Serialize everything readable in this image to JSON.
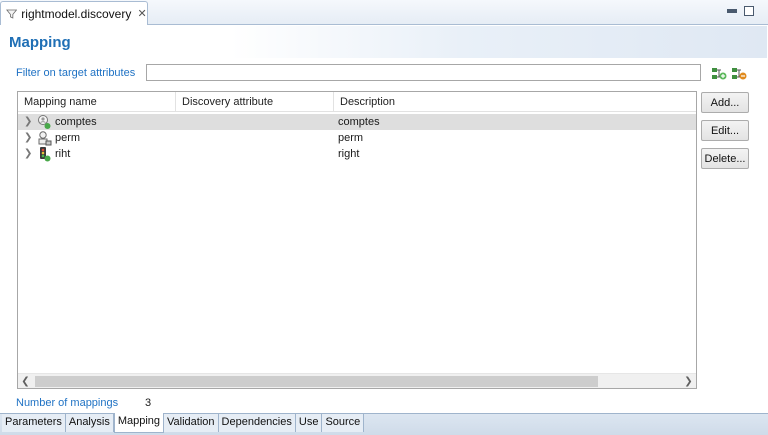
{
  "editor_tab": {
    "label": "rightmodel.discovery",
    "icon": "filter-icon"
  },
  "page_title": "Mapping",
  "filter": {
    "label": "Filter on target attributes",
    "value": "",
    "placeholder": ""
  },
  "table": {
    "columns": [
      "Mapping name",
      "Discovery attribute",
      "Description"
    ],
    "rows": [
      {
        "name": "comptes",
        "discovery_attribute": "",
        "description": "comptes",
        "icon": "account-icon",
        "selected": true
      },
      {
        "name": "perm",
        "discovery_attribute": "",
        "description": "perm",
        "icon": "permission-icon",
        "selected": false
      },
      {
        "name": "riht",
        "discovery_attribute": "",
        "description": "right",
        "icon": "right-icon",
        "selected": false
      }
    ]
  },
  "buttons": {
    "add": "Add...",
    "edit": "Edit...",
    "delete": "Delete..."
  },
  "mapping_count": {
    "label": "Number of mappings",
    "value": "3"
  },
  "page_tabs": [
    {
      "label": "Parameters",
      "active": false
    },
    {
      "label": "Analysis",
      "active": false
    },
    {
      "label": "Mapping",
      "active": true
    },
    {
      "label": "Validation",
      "active": false
    },
    {
      "label": "Dependencies",
      "active": false
    },
    {
      "label": "Use",
      "active": false
    },
    {
      "label": "Source",
      "active": false
    }
  ],
  "colors": {
    "accent": "#1f6fb5",
    "link_label": "#1f72c4",
    "selection": "#dedede",
    "tab_border": "#a9bcd3"
  }
}
